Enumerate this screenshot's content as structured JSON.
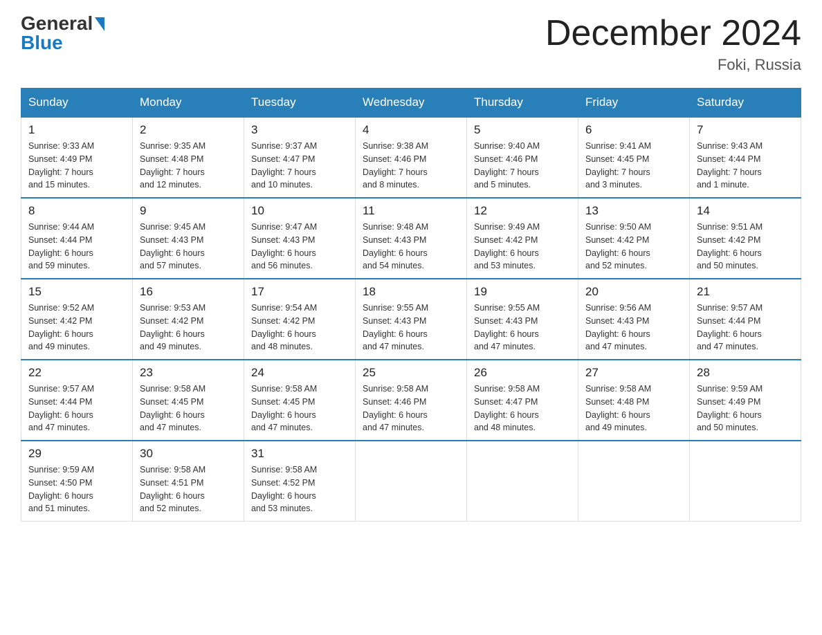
{
  "logo": {
    "general": "General",
    "blue": "Blue"
  },
  "title": "December 2024",
  "location": "Foki, Russia",
  "days_header": [
    "Sunday",
    "Monday",
    "Tuesday",
    "Wednesday",
    "Thursday",
    "Friday",
    "Saturday"
  ],
  "weeks": [
    [
      {
        "day": "1",
        "sunrise": "9:33 AM",
        "sunset": "4:49 PM",
        "daylight": "7 hours and 15 minutes."
      },
      {
        "day": "2",
        "sunrise": "9:35 AM",
        "sunset": "4:48 PM",
        "daylight": "7 hours and 12 minutes."
      },
      {
        "day": "3",
        "sunrise": "9:37 AM",
        "sunset": "4:47 PM",
        "daylight": "7 hours and 10 minutes."
      },
      {
        "day": "4",
        "sunrise": "9:38 AM",
        "sunset": "4:46 PM",
        "daylight": "7 hours and 8 minutes."
      },
      {
        "day": "5",
        "sunrise": "9:40 AM",
        "sunset": "4:46 PM",
        "daylight": "7 hours and 5 minutes."
      },
      {
        "day": "6",
        "sunrise": "9:41 AM",
        "sunset": "4:45 PM",
        "daylight": "7 hours and 3 minutes."
      },
      {
        "day": "7",
        "sunrise": "9:43 AM",
        "sunset": "4:44 PM",
        "daylight": "7 hours and 1 minute."
      }
    ],
    [
      {
        "day": "8",
        "sunrise": "9:44 AM",
        "sunset": "4:44 PM",
        "daylight": "6 hours and 59 minutes."
      },
      {
        "day": "9",
        "sunrise": "9:45 AM",
        "sunset": "4:43 PM",
        "daylight": "6 hours and 57 minutes."
      },
      {
        "day": "10",
        "sunrise": "9:47 AM",
        "sunset": "4:43 PM",
        "daylight": "6 hours and 56 minutes."
      },
      {
        "day": "11",
        "sunrise": "9:48 AM",
        "sunset": "4:43 PM",
        "daylight": "6 hours and 54 minutes."
      },
      {
        "day": "12",
        "sunrise": "9:49 AM",
        "sunset": "4:42 PM",
        "daylight": "6 hours and 53 minutes."
      },
      {
        "day": "13",
        "sunrise": "9:50 AM",
        "sunset": "4:42 PM",
        "daylight": "6 hours and 52 minutes."
      },
      {
        "day": "14",
        "sunrise": "9:51 AM",
        "sunset": "4:42 PM",
        "daylight": "6 hours and 50 minutes."
      }
    ],
    [
      {
        "day": "15",
        "sunrise": "9:52 AM",
        "sunset": "4:42 PM",
        "daylight": "6 hours and 49 minutes."
      },
      {
        "day": "16",
        "sunrise": "9:53 AM",
        "sunset": "4:42 PM",
        "daylight": "6 hours and 49 minutes."
      },
      {
        "day": "17",
        "sunrise": "9:54 AM",
        "sunset": "4:42 PM",
        "daylight": "6 hours and 48 minutes."
      },
      {
        "day": "18",
        "sunrise": "9:55 AM",
        "sunset": "4:43 PM",
        "daylight": "6 hours and 47 minutes."
      },
      {
        "day": "19",
        "sunrise": "9:55 AM",
        "sunset": "4:43 PM",
        "daylight": "6 hours and 47 minutes."
      },
      {
        "day": "20",
        "sunrise": "9:56 AM",
        "sunset": "4:43 PM",
        "daylight": "6 hours and 47 minutes."
      },
      {
        "day": "21",
        "sunrise": "9:57 AM",
        "sunset": "4:44 PM",
        "daylight": "6 hours and 47 minutes."
      }
    ],
    [
      {
        "day": "22",
        "sunrise": "9:57 AM",
        "sunset": "4:44 PM",
        "daylight": "6 hours and 47 minutes."
      },
      {
        "day": "23",
        "sunrise": "9:58 AM",
        "sunset": "4:45 PM",
        "daylight": "6 hours and 47 minutes."
      },
      {
        "day": "24",
        "sunrise": "9:58 AM",
        "sunset": "4:45 PM",
        "daylight": "6 hours and 47 minutes."
      },
      {
        "day": "25",
        "sunrise": "9:58 AM",
        "sunset": "4:46 PM",
        "daylight": "6 hours and 47 minutes."
      },
      {
        "day": "26",
        "sunrise": "9:58 AM",
        "sunset": "4:47 PM",
        "daylight": "6 hours and 48 minutes."
      },
      {
        "day": "27",
        "sunrise": "9:58 AM",
        "sunset": "4:48 PM",
        "daylight": "6 hours and 49 minutes."
      },
      {
        "day": "28",
        "sunrise": "9:59 AM",
        "sunset": "4:49 PM",
        "daylight": "6 hours and 50 minutes."
      }
    ],
    [
      {
        "day": "29",
        "sunrise": "9:59 AM",
        "sunset": "4:50 PM",
        "daylight": "6 hours and 51 minutes."
      },
      {
        "day": "30",
        "sunrise": "9:58 AM",
        "sunset": "4:51 PM",
        "daylight": "6 hours and 52 minutes."
      },
      {
        "day": "31",
        "sunrise": "9:58 AM",
        "sunset": "4:52 PM",
        "daylight": "6 hours and 53 minutes."
      },
      null,
      null,
      null,
      null
    ]
  ]
}
